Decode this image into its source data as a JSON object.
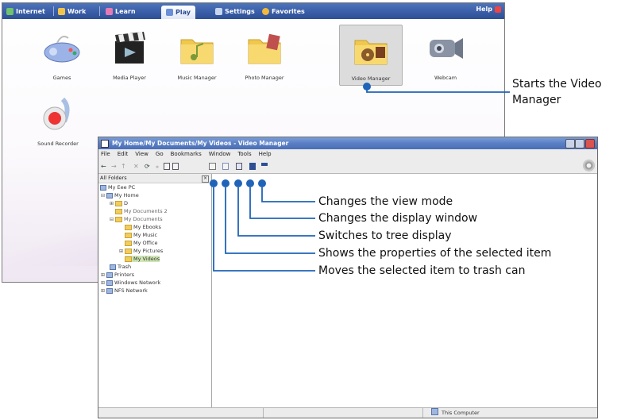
{
  "launcher": {
    "tabs": [
      "Internet",
      "Work",
      "Learn",
      "Play",
      "Settings",
      "Favorites"
    ],
    "help": "Help",
    "apps": [
      {
        "label": "Games",
        "icon": "gamepad-icon"
      },
      {
        "label": "Media Player",
        "icon": "clapperboard-icon"
      },
      {
        "label": "Music Manager",
        "icon": "music-folder-icon"
      },
      {
        "label": "Photo Manager",
        "icon": "photo-folder-icon"
      },
      {
        "label": "Video Manager",
        "icon": "video-folder-icon",
        "selected": true
      },
      {
        "label": "Webcam",
        "icon": "webcam-icon"
      },
      {
        "label": "Sound Recorder",
        "icon": "sound-recorder-icon"
      }
    ]
  },
  "video_manager": {
    "title": "My Home/My Documents/My Videos - Video Manager",
    "menu": [
      "File",
      "Edit",
      "View",
      "Go",
      "Bookmarks",
      "Window",
      "Tools",
      "Help"
    ],
    "tree_header": "All Folders",
    "tree": [
      "My Eee PC",
      "My Home",
      "D",
      "My Documents 2",
      "My Documents",
      "My Ebooks",
      "My Music",
      "My Office",
      "My Pictures",
      "My Videos",
      "Trash",
      "Printers",
      "Windows Network",
      "NFS Network"
    ],
    "status": "This Computer"
  },
  "callouts": {
    "starts_line1": "Starts the Video",
    "starts_line2": "Manager",
    "view_mode": "Changes the view mode",
    "display_window": "Changes the display window",
    "tree_display": "Switches to tree display",
    "properties": "Shows the properties of the selected item",
    "trash": "Moves the selected item to trash can"
  },
  "colors": {
    "callout_line": "#1f64b8",
    "tab_bar": "#3a5ea8",
    "title_bar": "#5a7fc4"
  }
}
